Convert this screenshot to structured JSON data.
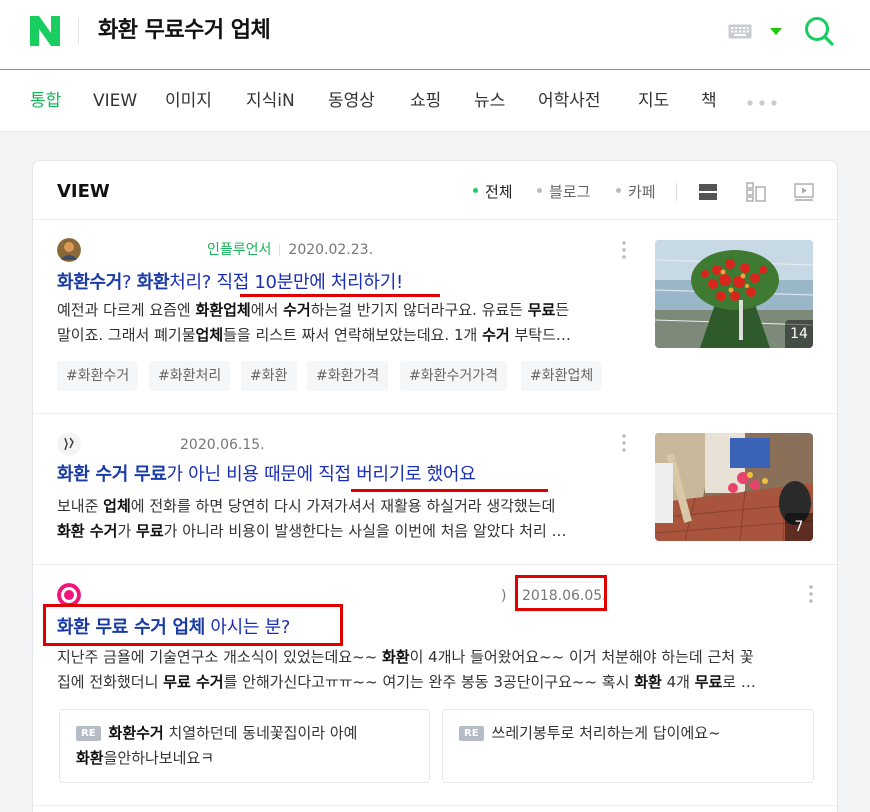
{
  "header": {
    "query": "화환 무료수거 업체",
    "colors": {
      "brand": "#19ce60",
      "link": "#1a2fb6",
      "highlight": "#e00000"
    },
    "icons": [
      "naver-logo-icon",
      "keyboard-icon",
      "chevron-down-icon",
      "search-icon"
    ]
  },
  "tabs": {
    "items": [
      "통합",
      "VIEW",
      "이미지",
      "지식iN",
      "동영상",
      "쇼핑",
      "뉴스",
      "어학사전",
      "지도",
      "책"
    ],
    "active": "통합"
  },
  "view": {
    "title": "VIEW",
    "filters": [
      "전체",
      "블로그",
      "카페"
    ],
    "active_filter": "전체",
    "view_icons": [
      "list-view-icon",
      "split-view-icon",
      "video-view-icon"
    ]
  },
  "results": [
    {
      "badge": "인플루언서",
      "date": "2020.02.23.",
      "title_parts": [
        {
          "t": "화환수거",
          "b": true
        },
        {
          "t": "? ",
          "b": false
        },
        {
          "t": "화환",
          "b": true
        },
        {
          "t": "처리? 직접 10분만에 처리하기!",
          "b": false
        }
      ],
      "desc_lines": [
        [
          {
            "t": "예전과 다르게 요즘엔 ",
            "b": false
          },
          {
            "t": "화환업체",
            "b": true
          },
          {
            "t": "에서 ",
            "b": false
          },
          {
            "t": "수거",
            "b": true
          },
          {
            "t": "하는걸 반기지 않더라구요. 유료든 ",
            "b": false
          },
          {
            "t": "무료",
            "b": true
          },
          {
            "t": "든",
            "b": false
          }
        ],
        [
          {
            "t": "말이죠. 그래서 폐기물",
            "b": false
          },
          {
            "t": "업체",
            "b": true
          },
          {
            "t": "들을 리스트 짜서 연락해보았는데요. 1개 ",
            "b": false
          },
          {
            "t": "수거",
            "b": true
          },
          {
            "t": " 부탁드…",
            "b": false
          }
        ]
      ],
      "hashtags": [
        "#화환수거",
        "#화환처리",
        "#화환",
        "#화환가격",
        "#화환수거가격",
        "#화환업체"
      ],
      "thumb_count": "14"
    },
    {
      "date": "2020.06.15.",
      "title_parts": [
        {
          "t": "화환 수거 무료",
          "b": true
        },
        {
          "t": "가 아닌 비용 때문에 직접 버리기로 했어요",
          "b": false
        }
      ],
      "desc_lines": [
        [
          {
            "t": "보내준 ",
            "b": false
          },
          {
            "t": "업체",
            "b": true
          },
          {
            "t": "에 전화를 하면 당연히 다시 가져가셔서 재활용 하실거라 생각했는데",
            "b": false
          }
        ],
        [
          {
            "t": "화환 수거",
            "b": true
          },
          {
            "t": "가 ",
            "b": false
          },
          {
            "t": "무료",
            "b": true
          },
          {
            "t": "가 아니라 비용이 발생한다는 사실을 이번에 처음 알았다 처리 …",
            "b": false
          }
        ]
      ],
      "thumb_count": "7"
    },
    {
      "paren": ")",
      "date": "2018.06.05.",
      "title_parts": [
        {
          "t": "화환 무료 수거 업체",
          "b": true
        },
        {
          "t": " 아시는 분?",
          "b": false
        }
      ],
      "desc_lines": [
        [
          {
            "t": "지난주 금욜에 기술연구소 개소식이 있었는데요~~ ",
            "b": false
          },
          {
            "t": "화환",
            "b": true
          },
          {
            "t": "이 4개나 들어왔어요~~ 이거 처분해야 하는데 근처 꽃",
            "b": false
          }
        ],
        [
          {
            "t": "집에 전화했더니 ",
            "b": false
          },
          {
            "t": "무료 수거",
            "b": true
          },
          {
            "t": "를 안해가신다고ㅠㅠ~~ 여기는 완주 봉동 3공단이구요~~ 혹시 ",
            "b": false
          },
          {
            "t": "화환",
            "b": true
          },
          {
            "t": " 4개 ",
            "b": false
          },
          {
            "t": "무료",
            "b": true
          },
          {
            "t": "로 …",
            "b": false
          }
        ]
      ],
      "replies": [
        {
          "badge": "RE",
          "lines": [
            [
              {
                "t": "화환수거",
                "b": true
              },
              {
                "t": " 치열하던데 동네꽃집이라 아예",
                "b": false
              }
            ],
            [
              {
                "t": "화환",
                "b": true
              },
              {
                "t": "을안하나보네요ㅋ",
                "b": false
              }
            ]
          ]
        },
        {
          "badge": "RE",
          "lines": [
            [
              {
                "t": "쓰레기봉투로 처리하는게 답이에요~",
                "b": false
              }
            ]
          ]
        }
      ]
    }
  ]
}
